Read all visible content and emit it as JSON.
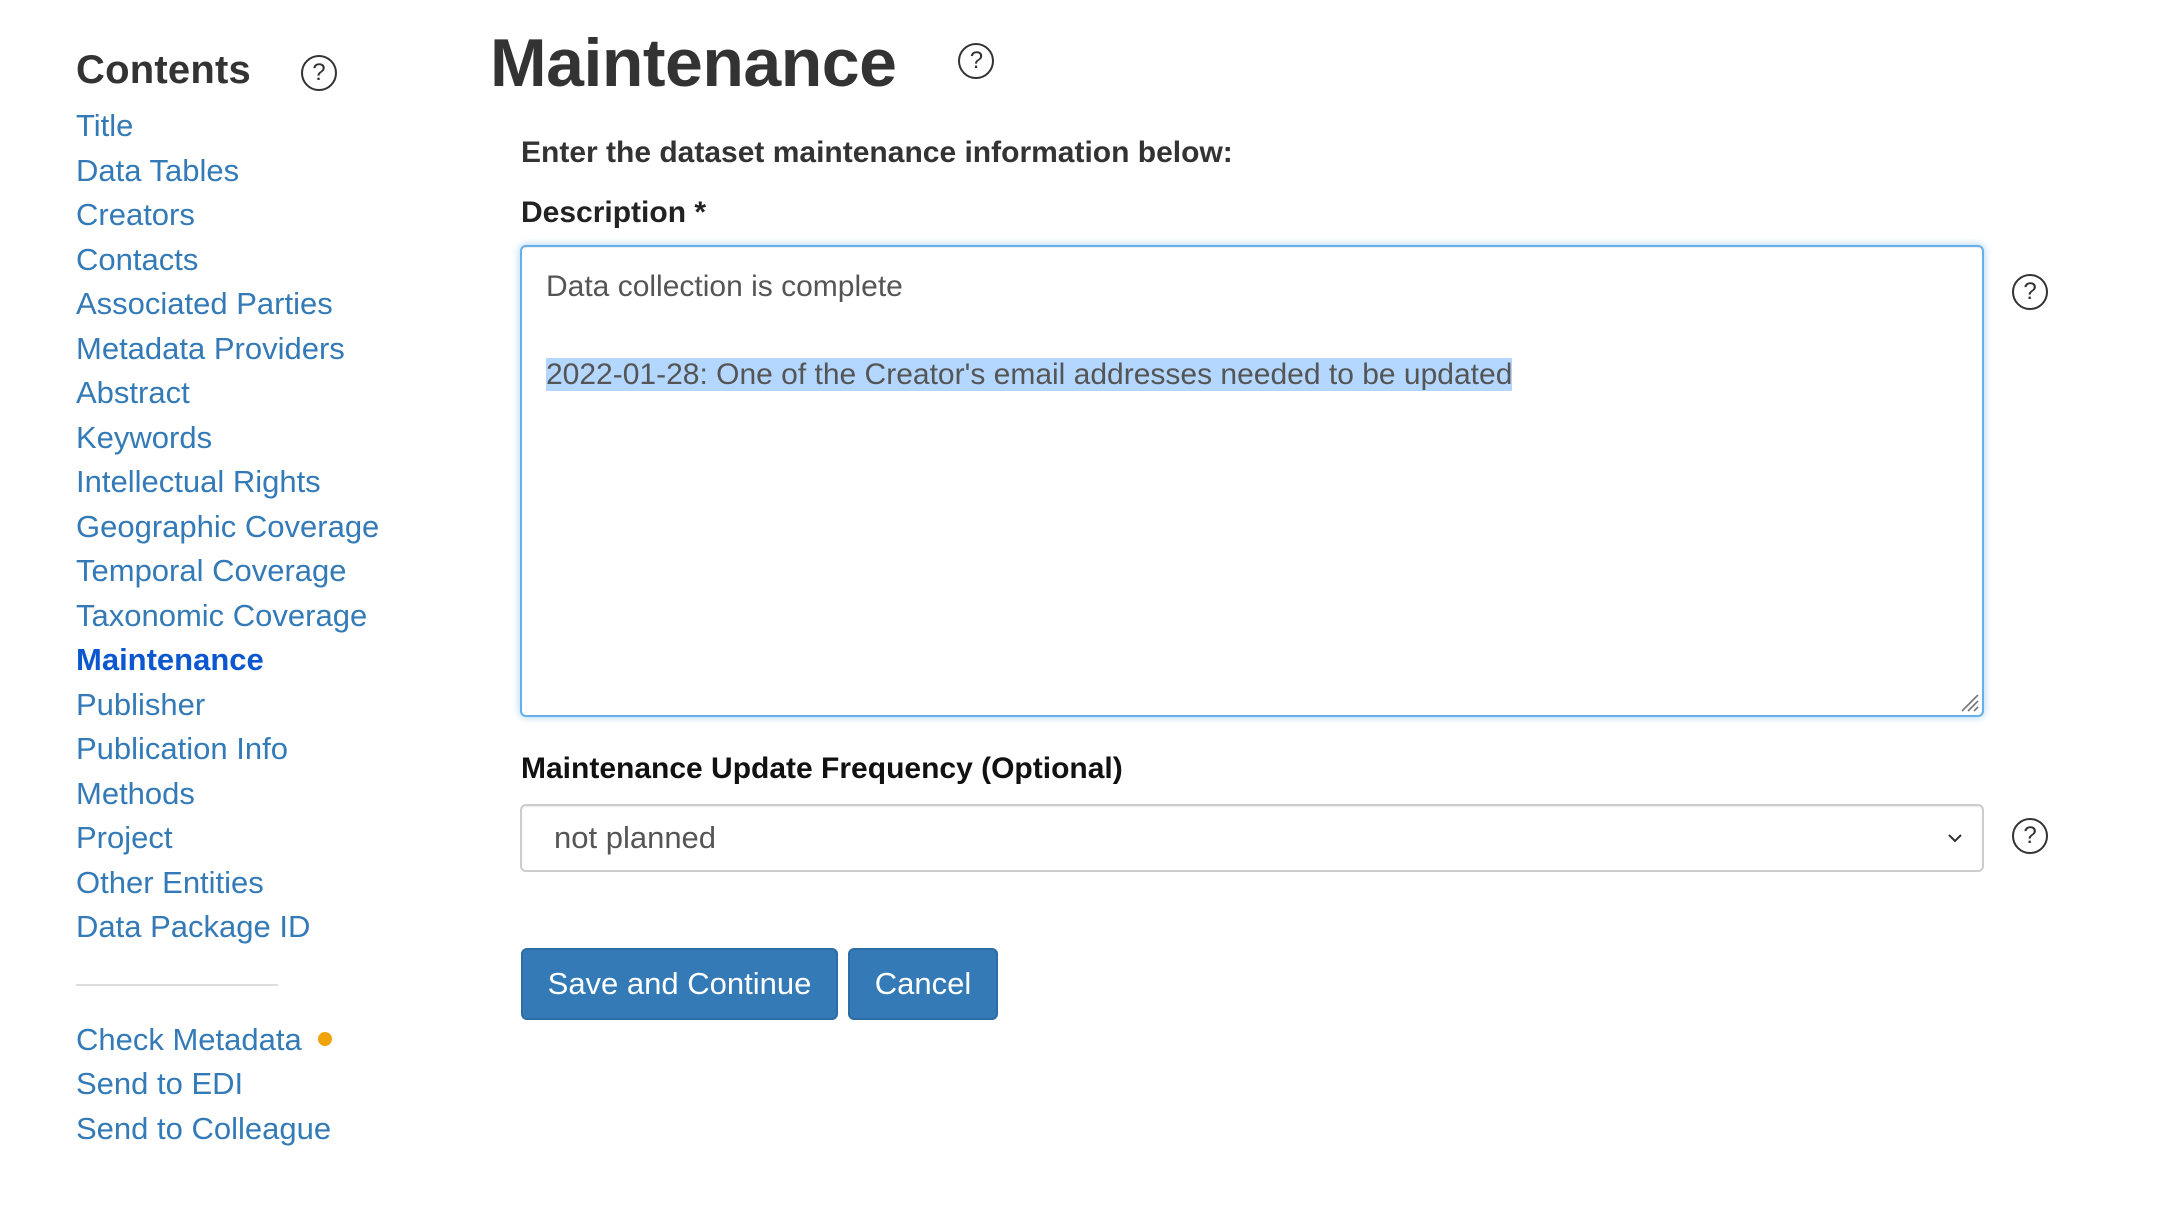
{
  "sidebar": {
    "title": "Contents",
    "help_icon": "question-circle-icon",
    "items": [
      {
        "label": "Title",
        "active": false
      },
      {
        "label": "Data Tables",
        "active": false
      },
      {
        "label": "Creators",
        "active": false
      },
      {
        "label": "Contacts",
        "active": false
      },
      {
        "label": "Associated Parties",
        "active": false
      },
      {
        "label": "Metadata Providers",
        "active": false
      },
      {
        "label": "Abstract",
        "active": false
      },
      {
        "label": "Keywords",
        "active": false
      },
      {
        "label": "Intellectual Rights",
        "active": false
      },
      {
        "label": "Geographic Coverage",
        "active": false
      },
      {
        "label": "Temporal Coverage",
        "active": false
      },
      {
        "label": "Taxonomic Coverage",
        "active": false
      },
      {
        "label": "Maintenance",
        "active": true
      },
      {
        "label": "Publisher",
        "active": false
      },
      {
        "label": "Publication Info",
        "active": false
      },
      {
        "label": "Methods",
        "active": false
      },
      {
        "label": "Project",
        "active": false
      },
      {
        "label": "Other Entities",
        "active": false
      },
      {
        "label": "Data Package ID",
        "active": false
      }
    ],
    "tools": [
      {
        "label": "Check Metadata",
        "status_dot_color": "#f0a30a"
      },
      {
        "label": "Send to EDI"
      },
      {
        "label": "Send to Colleague"
      }
    ]
  },
  "page": {
    "title": "Maintenance",
    "help_icon": "question-circle-icon",
    "intro": "Enter the dataset maintenance information below:"
  },
  "form": {
    "description": {
      "label": "Description *",
      "line1": "Data collection is complete",
      "line2": "",
      "line3_selected": "2022-01-28: One of the Creator's email addresses needed to be updated"
    },
    "frequency": {
      "label": "Maintenance Update Frequency (Optional)",
      "selected": "not planned"
    },
    "buttons": {
      "save": "Save and Continue",
      "cancel": "Cancel"
    }
  },
  "colors": {
    "link": "#337ab7",
    "active_link": "#0b57d0",
    "primary_button": "#337ab7",
    "selection": "#b4d7ff",
    "focus_border": "#66afe9",
    "status_dot": "#f0a30a"
  }
}
